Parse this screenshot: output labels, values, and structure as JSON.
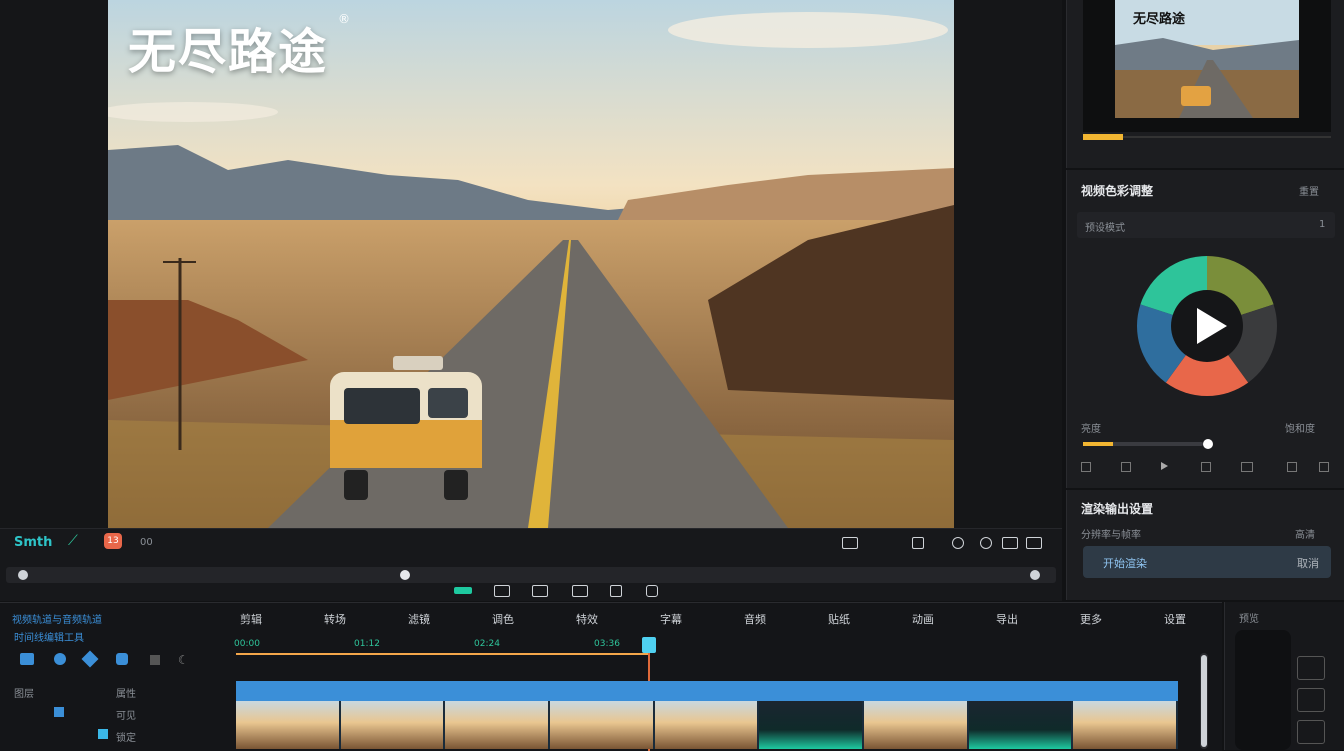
{
  "preview": {
    "logo": "无尽路途",
    "logo_mark": "®"
  },
  "thumb_panel": {
    "thumb_title": "无尽路途"
  },
  "color_panel": {
    "title": "视频色彩调整",
    "reset_label": "重置",
    "preset_label": "预设模式",
    "preset_value": "1",
    "slider_label": "亮度",
    "slider_right_label": "饱和度",
    "wheel_colors": [
      "#7a8e3a",
      "#3a3b3d",
      "#e8674a",
      "#2f6e9e",
      "#2ec49a"
    ]
  },
  "export_panel": {
    "title": "渲染输出设置",
    "sub_label": "分辨率与帧率",
    "sub_right": "高清",
    "primary_button": "开始渲染",
    "secondary_button": "取消"
  },
  "toolbar": {
    "app_label": "Smth",
    "record_badge": "13",
    "time_small": "00"
  },
  "timeline": {
    "left_header": "视频轨道与音频轨道",
    "left_sub": "时间线编辑工具",
    "layer_label": "图层",
    "layer_right": "属性",
    "row1_label": "可见",
    "row2_label": "锁定",
    "tabs": [
      "剪辑",
      "转场",
      "滤镜",
      "调色",
      "特效",
      "字幕",
      "音频",
      "贴纸",
      "动画",
      "导出",
      "更多",
      "设置"
    ],
    "marker_labels": [
      "00:00",
      "01:12",
      "02:24",
      "03:36"
    ],
    "right_panel_title": "预览"
  },
  "colors": {
    "accent": "#1ec9a0",
    "timeline_blue": "#3b8fd8",
    "playhead": "#f4a64a",
    "progress_yellow": "#f2b632"
  }
}
